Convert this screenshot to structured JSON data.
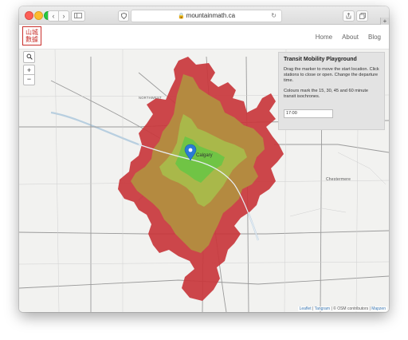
{
  "browser": {
    "url": "mountainmath.ca",
    "back_glyph": "‹",
    "forward_glyph": "›",
    "reload_glyph": "↻",
    "new_tab_glyph": "+",
    "icons": [
      "back-icon",
      "forward-icon",
      "sidebar-icon",
      "shield-icon",
      "lock-icon",
      "reload-icon",
      "share-icon",
      "tabs-icon",
      "new-tab-icon"
    ]
  },
  "header": {
    "logo_text": "山城數據",
    "nav": [
      "Home",
      "About",
      "Blog"
    ]
  },
  "map_controls": {
    "search_glyph": "⌕",
    "zoom_in": "+",
    "zoom_out": "−"
  },
  "panel": {
    "title": "Transit Mobility Playground",
    "paragraph1": "Drag the marker to move the start location. Click stations to close or open. Change the departure time.",
    "paragraph2": "Colours mark the 15, 30, 45 and 60 minute transit isochrones.",
    "time_value": "17:00"
  },
  "map_labels": {
    "northwest": "NORTHWEST",
    "city_label": "Calgary",
    "chestermere": "Chestermere"
  },
  "attribution": {
    "leaflet": "Leaflet",
    "separator1": " | ",
    "tangram": "Tangram",
    "separator2": " | © OSM contributors | ",
    "mapzen": "Mapzen"
  },
  "colors": {
    "isochrone_15": "#70c445",
    "isochrone_30": "#a9b84a",
    "isochrone_45": "#b48a40",
    "isochrone_60": "#c9373c",
    "marker": "#2b7bd6",
    "logo": "#c9302c"
  }
}
